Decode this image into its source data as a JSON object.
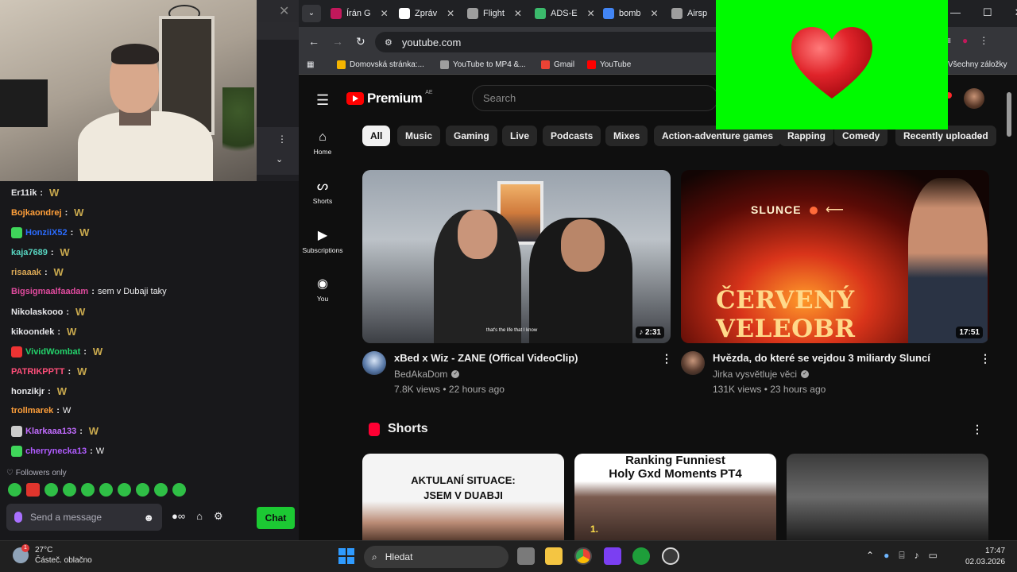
{
  "chat": {
    "lines": [
      {
        "user": "Er11ik",
        "message": "",
        "color": "#e7e7ea"
      },
      {
        "user": "Bojkaondrej",
        "message": "",
        "color": "#ff9f3a"
      },
      {
        "user": "HonziiX52",
        "message": "",
        "color": "#2b6cff"
      },
      {
        "user": "kaja7689",
        "message": "",
        "color": "#58d6c2"
      },
      {
        "user": "risaaak",
        "message": "",
        "color": "#d8a655"
      },
      {
        "user": "Bigsigmaalfaadam",
        "message": "sem v Dubaji taky",
        "color": "#e04b9e"
      },
      {
        "user": "Nikolaskooo",
        "message": "",
        "color": "#e7e7ea"
      },
      {
        "user": "kikoondek",
        "message": "",
        "color": "#e7e7ea"
      },
      {
        "user": "VividWombat",
        "message": "",
        "color": "#23d36b"
      },
      {
        "user": "PATRIKPPTT",
        "message": "",
        "color": "#ff4f7a"
      },
      {
        "user": "honzikjr",
        "message": "",
        "color": "#e7e7ea"
      },
      {
        "user": "trollmarek",
        "message": "W",
        "color": "#ff9f3a"
      },
      {
        "user": "Klarkaaa133",
        "message": "",
        "color": "#c26cff"
      },
      {
        "user": "cherrynecka13",
        "message": "W",
        "color": "#b05cff"
      }
    ],
    "followers_only": "Followers only",
    "input_placeholder": "Send a message",
    "chat_button": "Chat"
  },
  "browser": {
    "tabs": [
      {
        "title": "Írán G",
        "color": "#c2185b"
      },
      {
        "title": "Zpráv",
        "color": "#ffffff"
      },
      {
        "title": "Flight",
        "color": "#9e9e9e"
      },
      {
        "title": "ADS-E",
        "color": "#3bba6c"
      },
      {
        "title": "bomb",
        "color": "#4285f4"
      },
      {
        "title": "Airsp",
        "color": "#9e9e9e"
      }
    ],
    "url": "youtube.com",
    "bookmarks": [
      {
        "label": "Domovská stránka:...",
        "color": "#f4b400"
      },
      {
        "label": "YouTube to MP4 &...",
        "color": "#9e9e9e"
      },
      {
        "label": "Gmail",
        "color": "#ea4335"
      },
      {
        "label": "YouTube",
        "color": "#ff0000"
      }
    ],
    "all_bookmarks": "Všechny záložky"
  },
  "youtube": {
    "logo_text": "Premium",
    "logo_region": "AE",
    "search_placeholder": "Search",
    "sidebar": [
      {
        "label": "Home",
        "icon": "home-icon"
      },
      {
        "label": "Shorts",
        "icon": "shorts-icon"
      },
      {
        "label": "Subscriptions",
        "icon": "subscriptions-icon"
      },
      {
        "label": "You",
        "icon": "you-icon"
      }
    ],
    "chips": [
      "All",
      "Music",
      "Gaming",
      "Live",
      "Podcasts",
      "Mixes",
      "Action-adventure games",
      "Rapping",
      "Comedy",
      "Recently uploaded"
    ],
    "videos": [
      {
        "title": "xBed x Wiz - ZANE (Offical VideoClip)",
        "channel": "BedAkaDom",
        "meta": "7.8K views • 22 hours ago",
        "duration": "♪ 2:31",
        "caption": "that's the life that I know"
      },
      {
        "title": "Hvězda, do které se vejdou 3 miliardy Sluncí",
        "channel": "Jirka vysvětluje věci",
        "meta": "131K views • 23 hours ago",
        "duration": "17:51",
        "thumb_word": "SLUNCE",
        "thumb_title": "ČERVENÝ VELEOBR"
      }
    ],
    "shorts_label": "Shorts",
    "shorts": [
      {
        "text_line1": "AKTULANÍ SITUACE:",
        "text_line2": "JSEM V DUABJI"
      },
      {
        "text_line1": "Ranking Funniest",
        "text_line2": "Holy Gxd Moments PT4",
        "number": "1."
      },
      {
        "text_line1": "",
        "text_line2": ""
      }
    ]
  },
  "taskbar": {
    "temperature": "27°C",
    "weather": "Částeč. oblačno",
    "weather_badge": "1",
    "search": "Hledat",
    "time": "17:47",
    "date": "02.03.2026"
  }
}
